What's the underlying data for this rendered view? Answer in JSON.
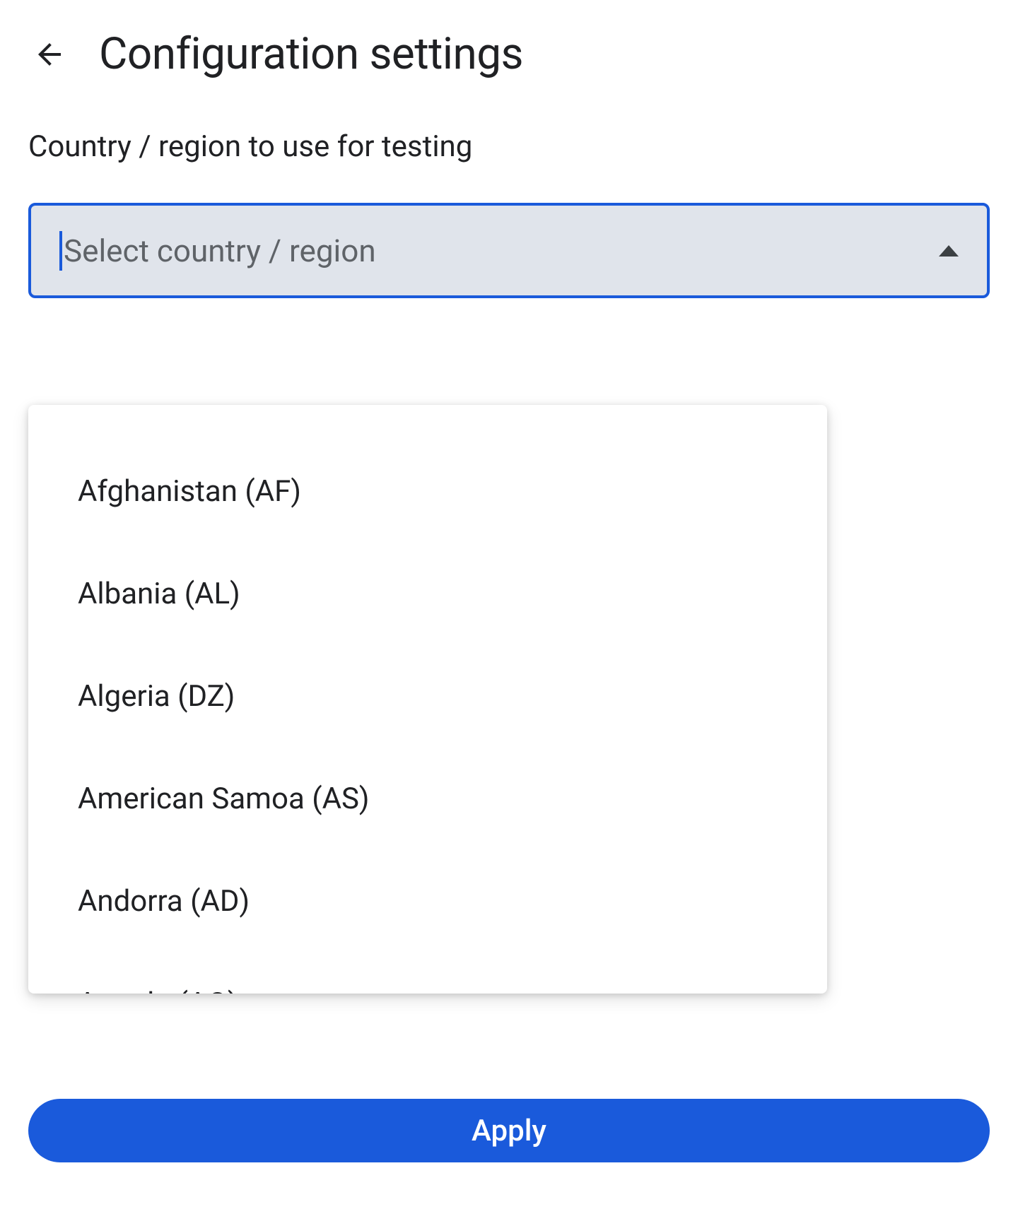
{
  "header": {
    "title": "Configuration settings"
  },
  "field": {
    "label": "Country / region to use for testing",
    "placeholder": "Select country / region"
  },
  "dropdown": {
    "options": [
      "Afghanistan (AF)",
      "Albania (AL)",
      "Algeria (DZ)",
      "American Samoa (AS)",
      "Andorra (AD)",
      "Angola (AO)"
    ]
  },
  "actions": {
    "apply_label": "Apply"
  }
}
